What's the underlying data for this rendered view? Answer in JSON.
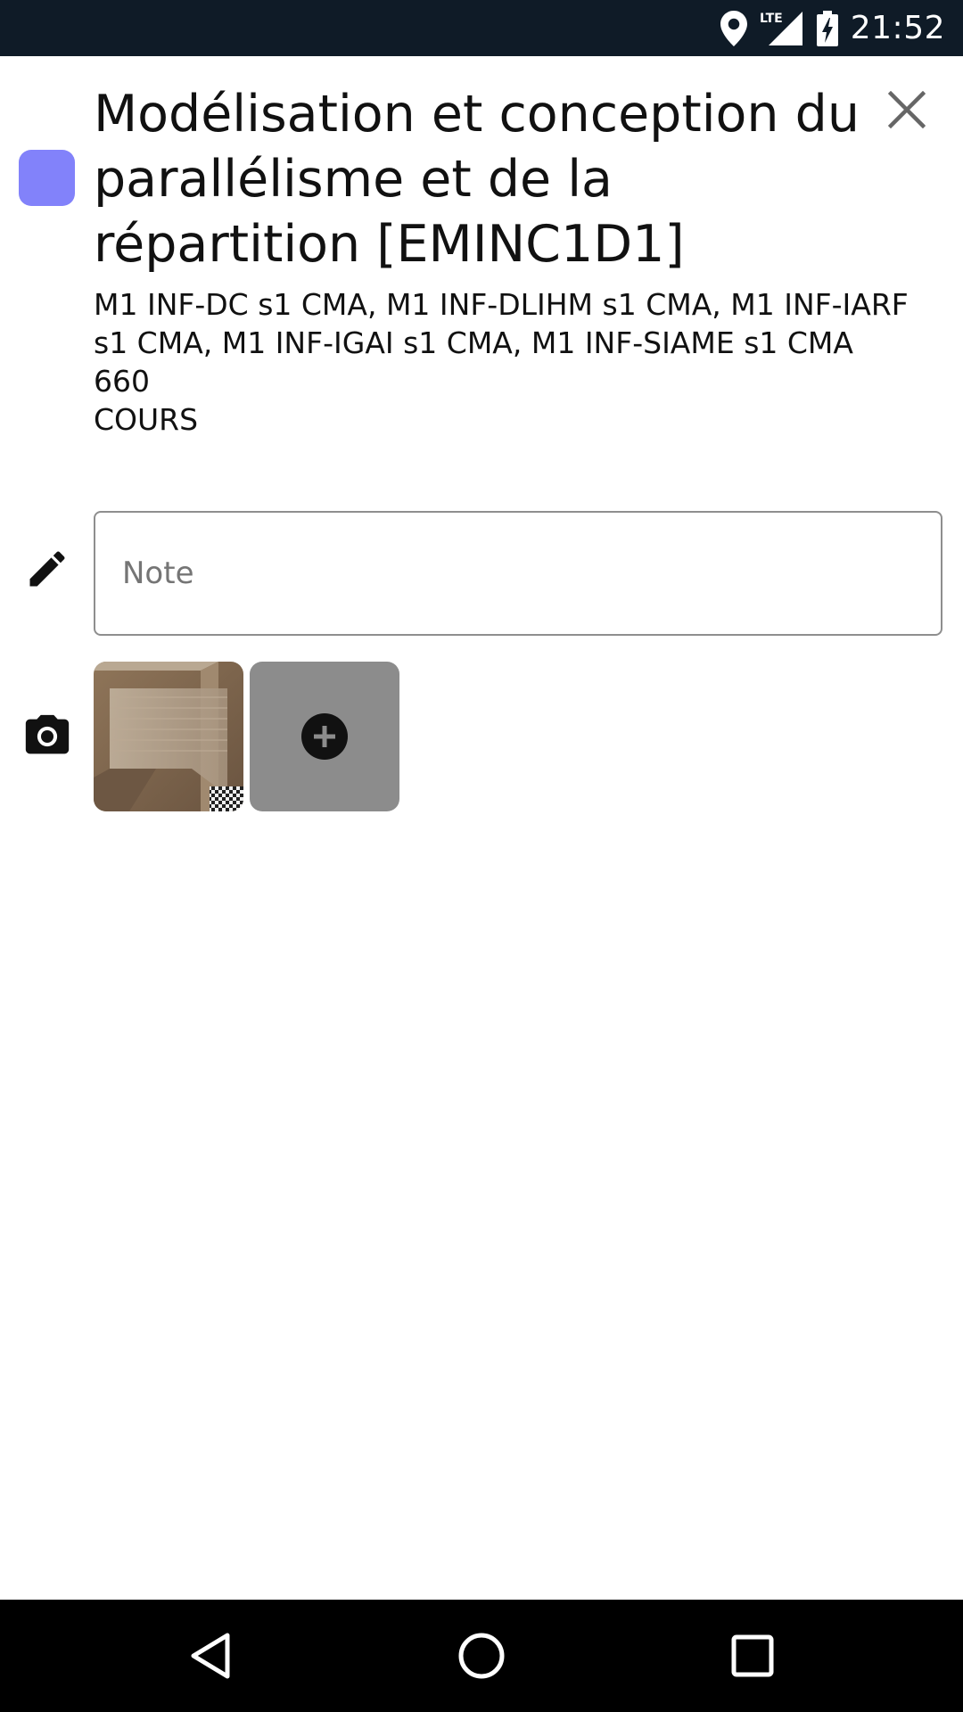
{
  "status_bar": {
    "time": "21:52",
    "network_label": "LTE",
    "icons": [
      "location-icon",
      "signal-icon",
      "battery-charging-icon"
    ]
  },
  "event": {
    "color": "#8282fa",
    "title": "Modélisation et conception du parallélisme et de la répartition [EMINC1D1]",
    "groups": "M1 INF-DC s1 CMA, M1 INF-DLIHM s1 CMA, M1 INF-IARF s1 CMA, M1 INF-IGAI s1 CMA, M1 INF-SIAME s1 CMA",
    "room": "660",
    "type": "COURS"
  },
  "note": {
    "placeholder": "Note",
    "value": ""
  },
  "photos": {
    "items": [
      "photo-thumbnail"
    ],
    "add_icon": "add-circle-icon"
  },
  "nav_bar": {
    "buttons": [
      "back-icon",
      "home-icon",
      "recents-icon"
    ]
  }
}
